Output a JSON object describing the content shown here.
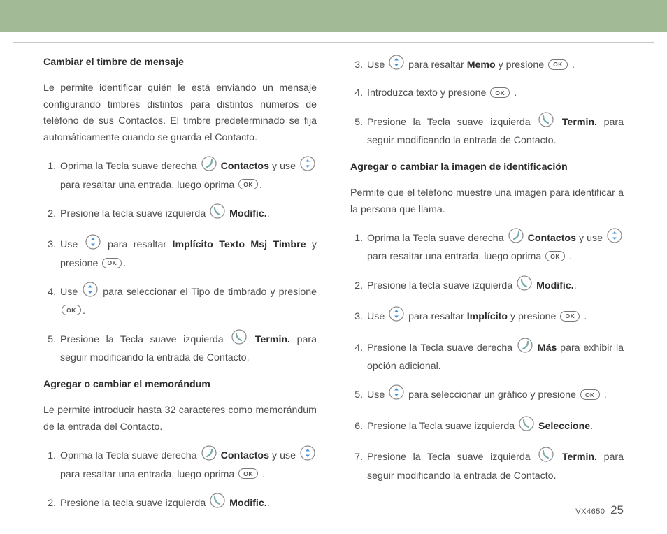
{
  "footer": {
    "model": "VX4650",
    "page": "25"
  },
  "icons": {
    "ok": "OK"
  },
  "left": {
    "s1": {
      "title": "Cambiar el timbre de mensaje",
      "intro": "Le permite identificar quién le está enviando un mensaje configurando timbres distintos para distintos números de teléfono de sus Contactos. El timbre predeterminado se fija automáticamente cuando se guarda el Contacto.",
      "i1a": "Oprima la Tecla suave derecha ",
      "i1b": "Contactos",
      "i1c": " y use ",
      "i1d": " para resaltar una entrada, luego oprima ",
      "i1e": ".",
      "i2a": "Presione la tecla suave izquierda ",
      "i2b": "Modific.",
      "i2c": ".",
      "i3a": "Use ",
      "i3b": " para resaltar ",
      "i3c": "Implícito Texto Msj Timbre",
      "i3d": " y presione ",
      "i3e": ".",
      "i4a": "Use ",
      "i4b": " para seleccionar el Tipo de timbrado y presione ",
      "i4e": ".",
      "i5a": "Presione la Tecla suave izquierda ",
      "i5b": "Termin.",
      "i5c": " para seguir modificando la entrada de Contacto."
    },
    "s2": {
      "title": "Agregar o cambiar el memorándum",
      "intro": "Le permite introducir hasta 32 caracteres como memorándum de la entrada del Contacto.",
      "i1a": "Oprima la Tecla suave derecha ",
      "i1b": "Contactos",
      "i1c": " y use ",
      "i1d": " para resaltar una entrada, luego oprima ",
      "i1e": " .",
      "i2a": "Presione la tecla suave izquierda ",
      "i2b": "Modific.",
      "i2c": "."
    }
  },
  "right": {
    "cont": {
      "i3a": "Use ",
      "i3b": " para resaltar ",
      "i3c": "Memo",
      "i3d": " y presione ",
      "i3e": " .",
      "i4a": "Introduzca texto y presione ",
      "i4e": " .",
      "i5a": "Presione la Tecla suave izquierda ",
      "i5b": "Termin.",
      "i5c": " para seguir modificando la entrada de Contacto."
    },
    "s3": {
      "title": "Agregar o cambiar la imagen de identificación",
      "intro": "Permite que el teléfono muestre una imagen para identificar a la persona  que llama.",
      "i1a": "Oprima la Tecla suave derecha ",
      "i1b": "Contactos",
      "i1c": " y use ",
      "i1d": " para resaltar una entrada, luego oprima ",
      "i1e": " .",
      "i2a": "Presione la tecla suave izquierda ",
      "i2b": "Modific.",
      "i2c": ".",
      "i3a": "Use ",
      "i3b": " para resaltar ",
      "i3c": "Implícito",
      "i3d": " y presione ",
      "i3e": " .",
      "i4a": "Presione la Tecla suave derecha ",
      "i4b": "Más",
      "i4c": " para exhibir la opción adicional.",
      "i5a": "Use ",
      "i5b": " para seleccionar un gráfico y presione ",
      "i5e": " .",
      "i6a": "Presione la Tecla suave izquierda ",
      "i6b": "Seleccione",
      "i6c": ".",
      "i7a": "Presione la Tecla suave izquierda ",
      "i7b": "Termin.",
      "i7c": " para seguir modificando la entrada de Contacto."
    }
  }
}
